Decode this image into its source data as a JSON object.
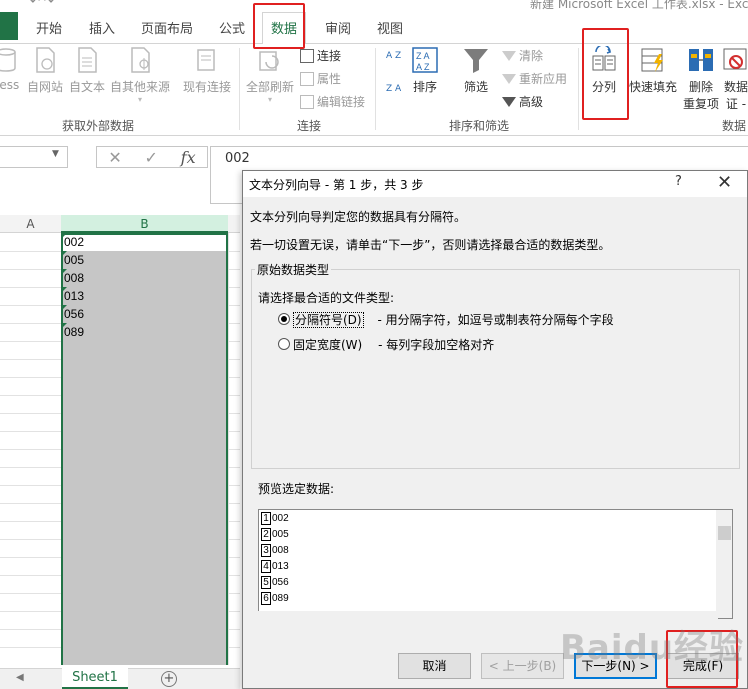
{
  "window": {
    "title": "新建 Microsoft Excel 工作表.xlsx - Excel"
  },
  "tabs": [
    {
      "label": "开始"
    },
    {
      "label": "插入"
    },
    {
      "label": "页面布局"
    },
    {
      "label": "公式"
    },
    {
      "label": "数据"
    },
    {
      "label": "审阅"
    },
    {
      "label": "视图"
    }
  ],
  "ribbon": {
    "get_external": {
      "label": "获取外部数据",
      "buttons": [
        "cess",
        "自网站",
        "自文本",
        "自其他来源",
        "现有连接"
      ]
    },
    "connections": {
      "label": "连接",
      "refresh_all": "全部刷新",
      "items": [
        "连接",
        "属性",
        "编辑链接"
      ]
    },
    "sort_filter": {
      "label": "排序和筛选",
      "sort_az": "A Z",
      "sort_za": "Z A",
      "sort": "排序",
      "filter": "筛选",
      "items": [
        "清除",
        "重新应用",
        "高级"
      ]
    },
    "data_tools": {
      "label": "数据",
      "text_to_columns": "分列",
      "flash_fill": "快速填充",
      "remove_dup_1": "删除",
      "remove_dup_2": "重复项",
      "validation_1": "数据",
      "validation_2": "证 -"
    }
  },
  "formula_bar": {
    "namebox": "",
    "fx": "fx",
    "value": "002"
  },
  "grid": {
    "columns": [
      "A",
      "B"
    ],
    "cells": [
      "002",
      "005",
      "008",
      "013",
      "056",
      "089"
    ]
  },
  "sheets": {
    "active": "Sheet1",
    "add": "+"
  },
  "dialog": {
    "title": "文本分列向导 - 第 1 步，共 3 步",
    "help": "?",
    "close": "✕",
    "line1": "文本分列向导判定您的数据具有分隔符。",
    "line2": "若一切设置无误，请单击“下一步”，否则请选择最合适的数据类型。",
    "group_title": "原始数据类型",
    "prompt": "请选择最合适的文件类型:",
    "options": [
      {
        "label": "分隔符号(D)",
        "desc": "- 用分隔字符，如逗号或制表符分隔每个字段",
        "selected": true
      },
      {
        "label": "固定宽度(W)",
        "desc": "- 每列字段加空格对齐",
        "selected": false
      }
    ],
    "preview_title": "预览选定数据:",
    "preview_rows": [
      {
        "n": "1",
        "v": "002"
      },
      {
        "n": "2",
        "v": "005"
      },
      {
        "n": "3",
        "v": "008"
      },
      {
        "n": "4",
        "v": "013"
      },
      {
        "n": "5",
        "v": "056"
      },
      {
        "n": "6",
        "v": "089"
      }
    ],
    "buttons": {
      "cancel": "取消",
      "back": "< 上一步(B)",
      "next": "下一步(N) >",
      "finish": "完成(F)"
    }
  },
  "watermark": "Baidu经验",
  "colors": {
    "excel_green": "#217346",
    "highlight_red": "#e02020"
  }
}
